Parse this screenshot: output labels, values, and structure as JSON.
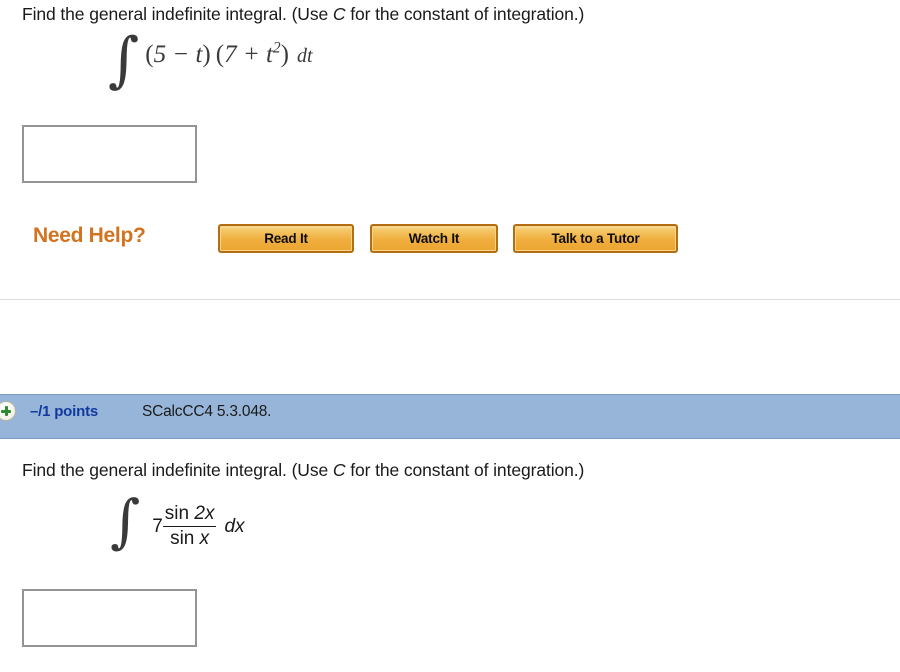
{
  "page": {
    "background_color": "#ffffff"
  },
  "problem_1": {
    "prompt_before_var": "Find the general indefinite integral. (Use ",
    "prompt_var": "C",
    "prompt_after_var": " for the constant of integration.)",
    "integral": {
      "integral_sign": "∫",
      "expression": "(5 − t) (7 + t²) dt",
      "factor_1_open": "(",
      "factor_1": "5 − t",
      "factor_1_close": ")",
      "factor_2_open": "(",
      "factor_2_base": "7 + t",
      "factor_2_exponent": "2",
      "factor_2_close": ")",
      "differential": "dt"
    },
    "answer_field": {
      "value": "",
      "placeholder": ""
    },
    "need_help": {
      "label": "Need Help?",
      "buttons": [
        {
          "label": "Read It",
          "name": "read-it-button"
        },
        {
          "label": "Watch It",
          "name": "watch-it-button"
        },
        {
          "label": "Talk to a Tutor",
          "name": "talk-to-a-tutor-button"
        }
      ],
      "accent_color": "#d2731f",
      "button_border_color": "#b36d12"
    }
  },
  "problem_2": {
    "points_bar": {
      "expand_icon": "plus-circle-icon",
      "points": "–/1 points",
      "code": "SCalcCC4 5.3.048.",
      "bar_color": "#97b5d8",
      "points_color": "#123a9e"
    },
    "prompt_before_var": "Find the general indefinite integral. (Use ",
    "prompt_var": "C",
    "prompt_after_var": " for the constant of integration.)",
    "integral": {
      "integral_sign": "∫",
      "coefficient": "7",
      "numerator_func": "sin ",
      "numerator_arg": "2x",
      "denominator_func": "sin ",
      "denominator_arg": "x",
      "differential": "dx"
    },
    "answer_field": {
      "value": "",
      "placeholder": ""
    }
  }
}
